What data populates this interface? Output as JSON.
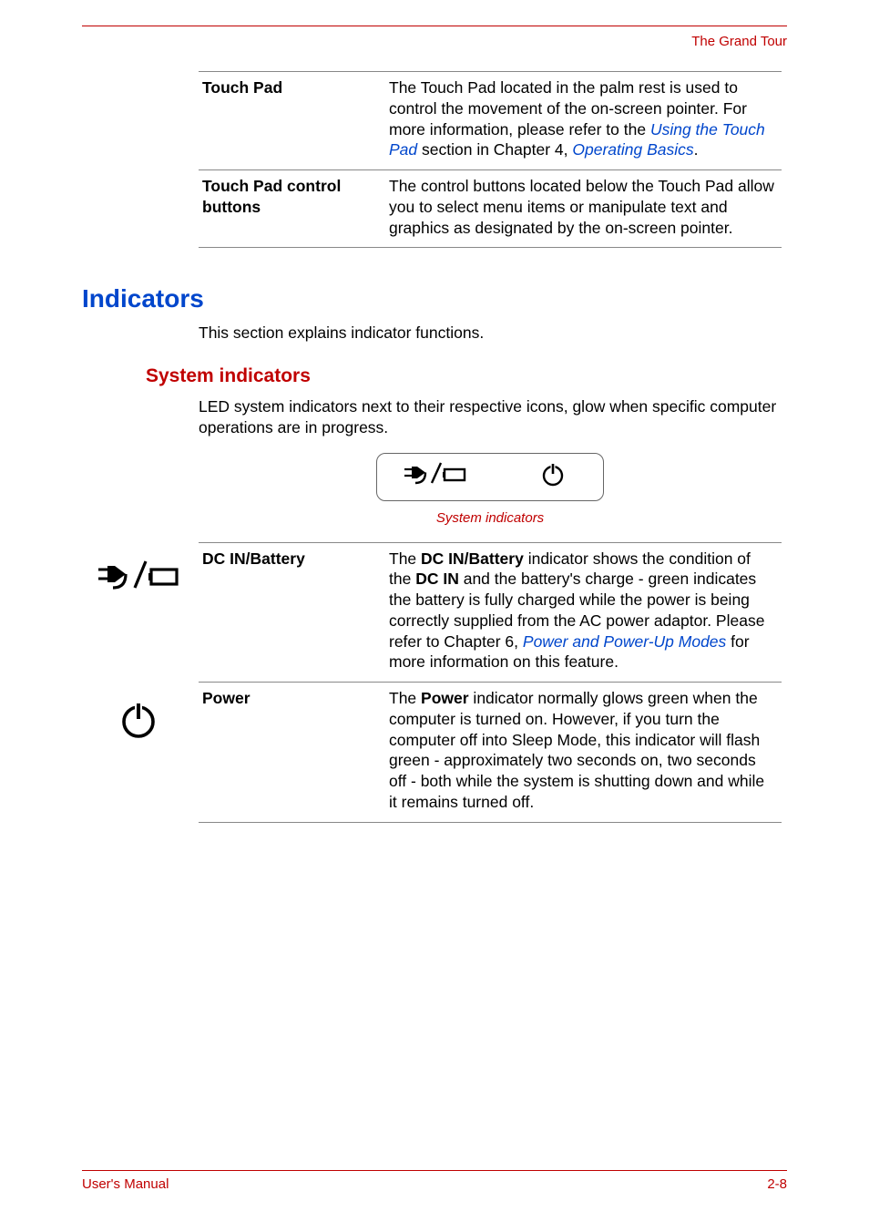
{
  "running_head": "The Grand Tour",
  "top_table": {
    "rows": [
      {
        "label": "Touch Pad",
        "desc_pre": "The Touch Pad located in the palm rest is used to control the movement of the on-screen pointer. For more information, please refer to the ",
        "link1": "Using the Touch Pad",
        "desc_mid": " section in Chapter 4, ",
        "link2": "Operating Basics",
        "desc_post": "."
      },
      {
        "label": "Touch Pad control buttons",
        "desc": "The control buttons located below the Touch Pad allow you to select menu items or manipulate text and graphics as designated by the on-screen pointer."
      }
    ]
  },
  "section": {
    "title": "Indicators",
    "intro": "This section explains indicator functions.",
    "subsection": {
      "title": "System indicators",
      "intro": "LED system indicators next to their respective icons, glow when specific computer operations are in progress.",
      "figure_caption": "System indicators"
    }
  },
  "ind_table": {
    "rows": [
      {
        "label": "DC IN/Battery",
        "desc_pre": "The ",
        "b1": "DC IN/Battery",
        "desc_mid1": " indicator shows the condition of the ",
        "b2": "DC IN",
        "desc_mid2": " and the battery's charge - green indicates the battery is fully charged while the power is being correctly supplied from the AC power adaptor. Please refer to Chapter 6, ",
        "link1": "Power and Power-Up Modes",
        "desc_post": " for more information on this feature."
      },
      {
        "label": "Power",
        "desc_pre": "The ",
        "b1": "Power",
        "desc_post": " indicator normally glows green when the computer is turned on. However, if you turn the computer off into Sleep Mode, this indicator will flash green - approximately two seconds on, two seconds off - both while the system is shutting down and while it remains turned off."
      }
    ]
  },
  "footer": {
    "left": "User's Manual",
    "right": "2-8"
  },
  "icons": {
    "dc_battery": "dc-in-battery-icon",
    "power": "power-icon"
  }
}
